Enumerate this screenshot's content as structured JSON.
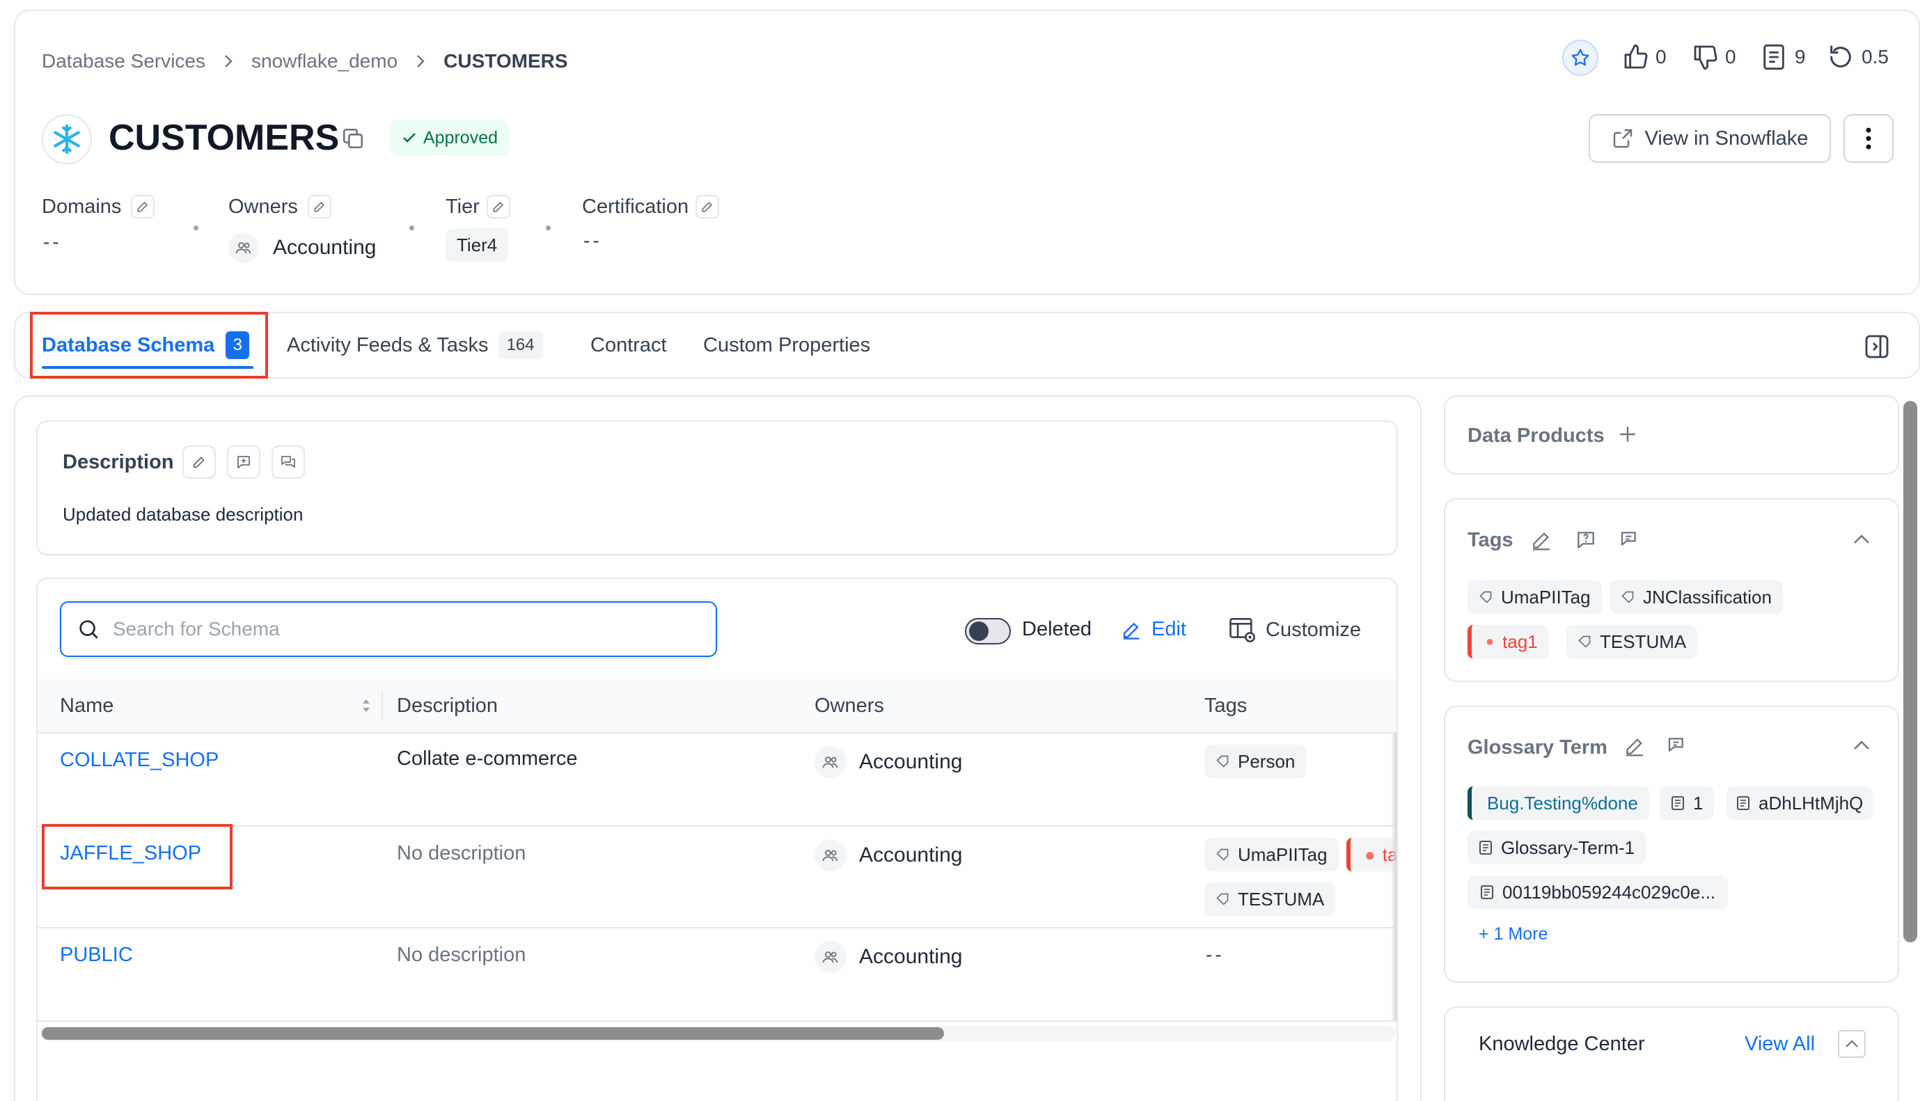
{
  "breadcrumb": {
    "items": [
      "Database Services",
      "snowflake_demo",
      "CUSTOMERS"
    ]
  },
  "header_actions": {
    "likes": "0",
    "dislikes": "0",
    "tasks": "9",
    "version": "0.5"
  },
  "entity": {
    "title": "CUSTOMERS",
    "status": "Approved",
    "view_button": "View in Snowflake"
  },
  "meta": {
    "domains_label": "Domains",
    "domains_value": "--",
    "owners_label": "Owners",
    "owners_value": "Accounting",
    "tier_label": "Tier",
    "tier_value": "Tier4",
    "certification_label": "Certification",
    "certification_value": "--"
  },
  "tabs": [
    {
      "label": "Database Schema",
      "count": "3"
    },
    {
      "label": "Activity Feeds & Tasks",
      "count": "164"
    },
    {
      "label": "Contract"
    },
    {
      "label": "Custom Properties"
    }
  ],
  "description": {
    "heading": "Description",
    "text": "Updated database description"
  },
  "toolbar": {
    "search_placeholder": "Search for Schema",
    "deleted_label": "Deleted",
    "edit_label": "Edit",
    "customize_label": "Customize"
  },
  "table": {
    "columns": [
      "Name",
      "Description",
      "Owners",
      "Tags"
    ],
    "rows": [
      {
        "name": "COLLATE_SHOP",
        "description": "Collate e-commerce",
        "owner": "Accounting",
        "tags": [
          "Person"
        ]
      },
      {
        "name": "JAFFLE_SHOP",
        "description": "No description",
        "owner": "Accounting",
        "tags": [
          "UmaPIITag",
          "ta",
          "TESTUMA"
        ]
      },
      {
        "name": "PUBLIC",
        "description": "No description",
        "owner": "Accounting",
        "tags_empty": "--"
      }
    ]
  },
  "side": {
    "data_products_label": "Data Products",
    "tags_label": "Tags",
    "tags": [
      "UmaPIITag",
      "JNClassification",
      "tag1",
      "TESTUMA"
    ],
    "glossary_label": "Glossary Term",
    "glossary_terms": [
      "Bug.Testing%done",
      "1",
      "aDhLHtMjhQ",
      "Glossary-Term-1",
      "00119bb059244c029c0e..."
    ],
    "glossary_more": "+ 1 More",
    "knowledge_label": "Knowledge Center",
    "view_all": "View All"
  },
  "colors": {
    "accent": "#1570ef",
    "highlight": "#e8402a",
    "approved_bg": "#ecfdf3",
    "approved_text": "#067647",
    "red_tag": "#f04438"
  }
}
